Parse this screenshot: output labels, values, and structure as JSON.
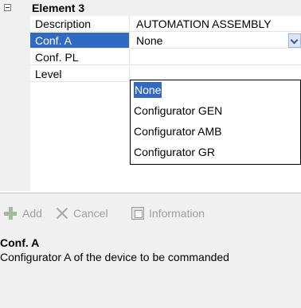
{
  "category": {
    "title": "Element 3",
    "expanded": true
  },
  "properties": [
    {
      "name": "Description",
      "value": "AUTOMATION ASSEMBLY"
    },
    {
      "name": "Conf. A",
      "value": "None",
      "selected": true,
      "has_dropdown": true
    },
    {
      "name": "Conf. PL",
      "value": ""
    },
    {
      "name": "Level",
      "value": ""
    }
  ],
  "dropdown": {
    "options": [
      "None",
      "Configurator GEN",
      "Configurator AMB",
      "Configurator GR"
    ],
    "selected_option": "None"
  },
  "toolbar": {
    "add_label": "Add",
    "cancel_label": "Cancel",
    "information_label": "Information"
  },
  "help": {
    "title": "Conf. A",
    "text": "Configurator A of the device to be commanded"
  },
  "colors": {
    "selection": "#316ac5",
    "panel_background": "#f0f0f0",
    "disabled_text": "#a0a0a0"
  }
}
